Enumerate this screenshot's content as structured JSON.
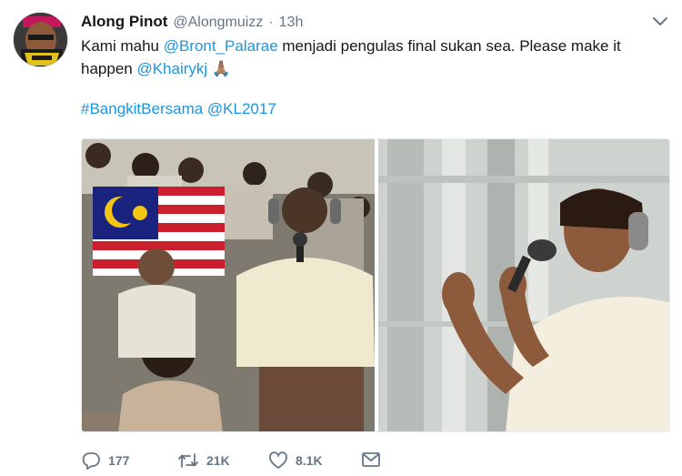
{
  "tweet": {
    "display_name": "Along Pinot",
    "handle": "@Alongmuizz",
    "separator": "·",
    "time": "13h",
    "text": {
      "line1_prefix": "Kami mahu ",
      "line1_mention": "@Bront_Palarae",
      "line1_suffix": " menjadi pengulas final sukan sea. Please make it",
      "line2_prefix": "happen ",
      "line2_mention": "@Khairykj",
      "line2_emoji": "🙏🏽",
      "line3_hashtag": "#BangkitBersama",
      "line3_space": " ",
      "line3_mention": "@KL2017"
    }
  },
  "actions": {
    "reply_count": "177",
    "retweet_count": "21K",
    "like_count": "8.1K"
  },
  "icons": {
    "caret": "chevron-down-icon",
    "reply": "reply-icon",
    "retweet": "retweet-icon",
    "like": "heart-icon",
    "dm": "envelope-icon"
  },
  "colors": {
    "link": "#1b95e0",
    "secondary_text": "#657786",
    "primary_text": "#14171a"
  }
}
